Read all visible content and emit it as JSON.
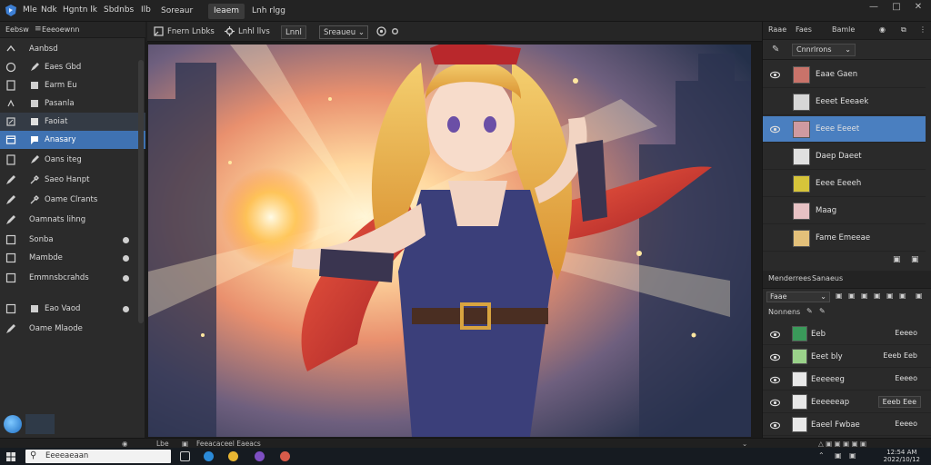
{
  "menu": {
    "items": [
      "Mle",
      "Ndk",
      "Hgntn lk",
      "Sbdnbs",
      "Ilb"
    ],
    "tabs": [
      "Soreaur",
      "Ieaem",
      "Lnh rlgg"
    ]
  },
  "options": {
    "tool_label": "Fnern Lnbks",
    "mode_label": "Lnhl llvs",
    "preset_label": "Lnnl",
    "blend_value": "Sreaueu"
  },
  "left_panel": {
    "header": "Eebsw",
    "header_dropdown": "Eeeoewnn",
    "items": [
      {
        "label": "Aanbsd",
        "selected": false
      },
      {
        "label": "Eaes Gbd",
        "selected": false
      },
      {
        "label": "Earm Eu",
        "selected": false
      },
      {
        "label": "Pasanla",
        "selected": false
      },
      {
        "label": "Faoiat",
        "selected": "dim"
      },
      {
        "label": "Anasary",
        "selected": true
      },
      {
        "label": "Oans iteg",
        "selected": false
      },
      {
        "label": "Saeo Hanpt",
        "selected": false
      },
      {
        "label": "Oame Clrants",
        "selected": false
      },
      {
        "label": "Oamnats lihng",
        "selected": false
      },
      {
        "label": "Sonba",
        "selected": false,
        "dot": true
      },
      {
        "label": "Mambde",
        "selected": false,
        "dot": true
      },
      {
        "label": "Emmnsbcrahds",
        "selected": false,
        "dot": true
      },
      {
        "label": "Eao Vaod",
        "selected": false,
        "dot": true
      },
      {
        "label": "Oame Mlaode",
        "selected": false
      }
    ]
  },
  "right_panel": {
    "top_tabs": [
      "Raae",
      "Faes",
      "Bamle"
    ],
    "top_dropdown": "Cnnrlrons",
    "pages": [
      {
        "label": "Eaae Gaen",
        "selected": false,
        "thumb": "#c9736a"
      },
      {
        "label": "Eeeet Eeeaek",
        "selected": false,
        "thumb": "#d7d7d7"
      },
      {
        "label": "Eeee Eeeet",
        "selected": true,
        "thumb": "#cf9aa0"
      },
      {
        "label": "Daep Daeet",
        "selected": false,
        "thumb": "#e0e0e0"
      },
      {
        "label": "Eeee Eeeeh",
        "selected": false,
        "thumb": "#d6c43a"
      },
      {
        "label": "Maag",
        "selected": false,
        "thumb": "#e7c2c4"
      },
      {
        "label": "Fame Emeeae",
        "selected": false,
        "thumb": "#e3c07a"
      }
    ],
    "layers_tabs": [
      "Menderrees",
      "Sanaeus"
    ],
    "layers_dropdown": "Faae",
    "layers_opacity_label": "Nonnens",
    "layers": [
      {
        "label": "Eeb",
        "value": "Eeeeo",
        "thumb": "#3a9a5a",
        "boxed": false
      },
      {
        "label": "Eeet bly",
        "value": "Eeeb Eeb",
        "thumb": "#9ad28a",
        "boxed": false
      },
      {
        "label": "Eeeeeeg",
        "value": "Eeeeo",
        "thumb": "#e8e8e8",
        "boxed": false
      },
      {
        "label": "Eeeeeeap",
        "value": "Eeeb Eee",
        "thumb": "#e8e8e8",
        "boxed": true
      },
      {
        "label": "Eaeel Fwbae",
        "value": "Eeeeo",
        "thumb": "#e8e8e8",
        "boxed": false
      }
    ]
  },
  "status": {
    "zoom": "Lbe",
    "info": "Feeacaceel Eaeacs"
  },
  "taskbar": {
    "search_placeholder": "Eeeeaeaan",
    "clock_time": "12:54 AM",
    "clock_date": "2022/10/12"
  },
  "colors": {
    "accent": "#3f72b2",
    "selection": "#4a7fc0",
    "panel": "#2b2b2b"
  }
}
